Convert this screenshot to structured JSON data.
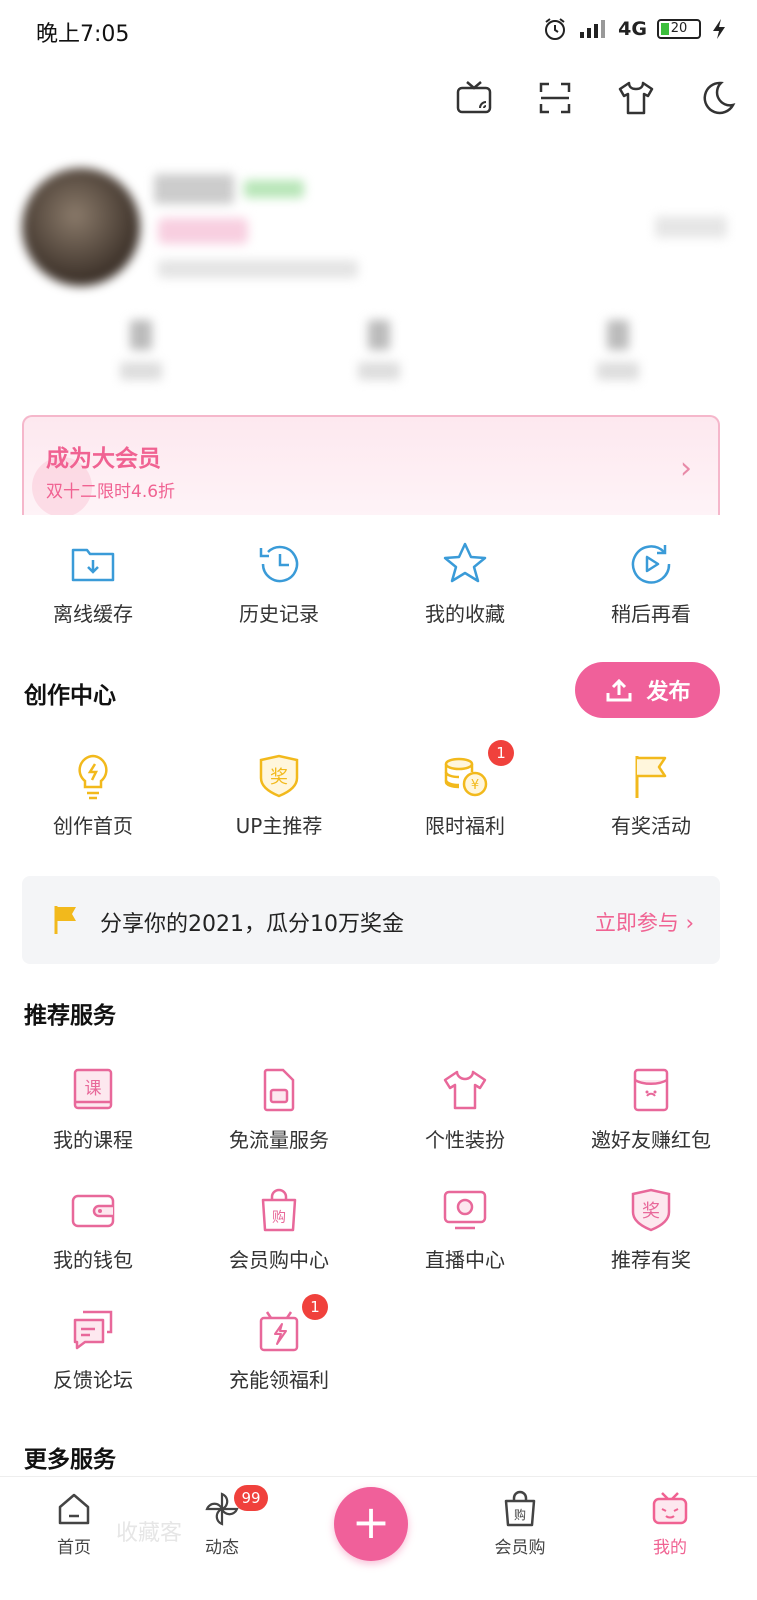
{
  "status_bar": {
    "time": "晚上7:05",
    "network": "4G",
    "battery": "20"
  },
  "vip_banner": {
    "title": "成为大会员",
    "subtitle": "双十二限时4.6折",
    "chevron": "›"
  },
  "quick_actions": [
    {
      "label": "离线缓存",
      "icon": "offline-download-icon"
    },
    {
      "label": "历史记录",
      "icon": "history-icon"
    },
    {
      "label": "我的收藏",
      "icon": "star-icon"
    },
    {
      "label": "稍后再看",
      "icon": "watch-later-icon"
    }
  ],
  "creation": {
    "title": "创作中心",
    "publish_label": "发布",
    "items": [
      {
        "label": "创作首页",
        "icon": "lightbulb-icon"
      },
      {
        "label": "UP主推荐",
        "icon": "award-badge-icon"
      },
      {
        "label": "限时福利",
        "icon": "coins-icon",
        "badge": "1"
      },
      {
        "label": "有奖活动",
        "icon": "flag-icon"
      }
    ]
  },
  "promo": {
    "text": "分享你的2021，瓜分10万奖金",
    "action": "立即参与 ›"
  },
  "recommended": {
    "title": "推荐服务",
    "items": [
      {
        "label": "我的课程",
        "icon": "course-book-icon"
      },
      {
        "label": "免流量服务",
        "icon": "sim-card-icon"
      },
      {
        "label": "个性装扮",
        "icon": "tshirt-icon"
      },
      {
        "label": "邀好友赚红包",
        "icon": "red-envelope-icon"
      },
      {
        "label": "我的钱包",
        "icon": "wallet-icon"
      },
      {
        "label": "会员购中心",
        "icon": "shopping-bag-icon"
      },
      {
        "label": "直播中心",
        "icon": "live-tv-icon"
      },
      {
        "label": "推荐有奖",
        "icon": "reward-badge-icon"
      },
      {
        "label": "反馈论坛",
        "icon": "feedback-chat-icon"
      },
      {
        "label": "充能领福利",
        "icon": "gift-charge-icon",
        "badge": "1"
      }
    ]
  },
  "more_services": {
    "title": "更多服务"
  },
  "bottom_nav": {
    "ghost_text": "收藏客",
    "items": [
      {
        "label": "首页",
        "icon": "home-icon"
      },
      {
        "label": "动态",
        "icon": "pinwheel-icon",
        "badge": "99"
      },
      {
        "label": "+",
        "icon": "plus-icon"
      },
      {
        "label": "会员购",
        "icon": "shopping-bag-icon"
      },
      {
        "label": "我的",
        "icon": "tv-mascot-icon"
      }
    ]
  },
  "colors": {
    "accent": "#f06292",
    "blue_icon": "#3a9bd8",
    "yellow_icon": "#f2b91c"
  }
}
